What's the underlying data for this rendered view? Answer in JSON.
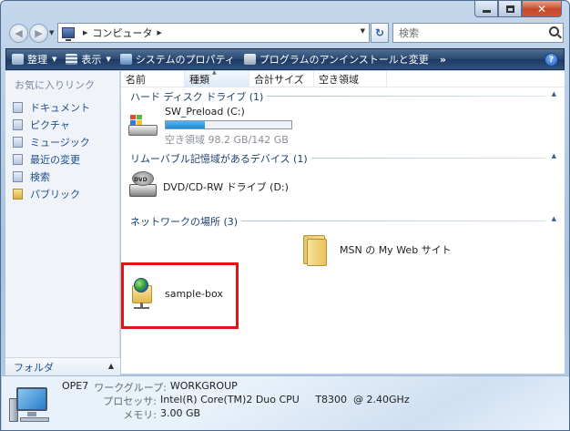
{
  "window": {
    "caption": {
      "minimize": "minimize",
      "maximize": "maximize",
      "close": "close"
    }
  },
  "address": {
    "segments": [
      "コンピュータ"
    ],
    "icon": "computer-icon"
  },
  "search": {
    "placeholder": "検索"
  },
  "toolbar": {
    "organize": "整理",
    "view": "表示",
    "system_properties": "システムのプロパティ",
    "uninstall": "プログラムのアンインストールと変更",
    "more": "»",
    "help": "?"
  },
  "sidebar": {
    "header": "お気に入りリンク",
    "items": [
      {
        "label": "ドキュメント",
        "icon": "documents-icon"
      },
      {
        "label": "ピクチャ",
        "icon": "pictures-icon"
      },
      {
        "label": "ミュージック",
        "icon": "music-icon"
      },
      {
        "label": "最近の変更",
        "icon": "recent-changes-icon"
      },
      {
        "label": "検索",
        "icon": "search-folder-icon"
      },
      {
        "label": "パブリック",
        "icon": "public-folder-icon"
      }
    ],
    "folders_label": "フォルダ"
  },
  "columns": [
    "名前",
    "種類",
    "合計サイズ",
    "空き領域"
  ],
  "groups": {
    "hdd": {
      "title": "ハード ディスク ドライブ (1)",
      "drive": {
        "name": "SW_Preload (C:)",
        "free_text": "空き領域 98.2 GB/142 GB",
        "used_fraction": 0.31
      }
    },
    "removable": {
      "title": "リムーバブル記憶域があるデバイス (1)",
      "drive": {
        "name": "DVD/CD-RW ドライブ (D:)"
      }
    },
    "network": {
      "title": "ネットワークの場所 (3)",
      "items": [
        {
          "name": "MSN の My Web サイト"
        },
        {
          "name": "sample-box"
        }
      ]
    }
  },
  "details": {
    "computer_name": "OPE7",
    "workgroup_label": "ワークグループ:",
    "workgroup": "WORKGROUP",
    "processor_label": "プロセッサ:",
    "processor": "Intel(R) Core(TM)2 Duo CPU     T8300  @ 2.40GHz",
    "memory_label": "メモリ:",
    "memory": "3.00 GB"
  },
  "colors": {
    "highlight": "#e01515",
    "toolbar": "#2a4770",
    "link": "#1b4f8f",
    "disk_fill": "#1c89d2"
  }
}
